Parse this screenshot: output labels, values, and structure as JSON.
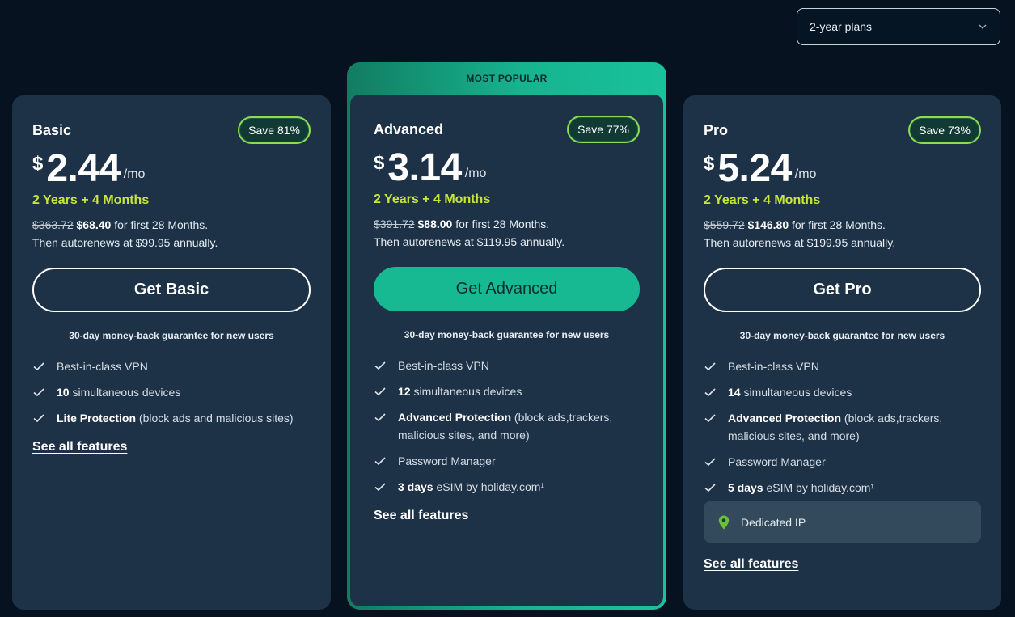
{
  "selector": {
    "value": "2-year plans",
    "icon": "chevron-down-icon"
  },
  "popular_label": "MOST POPULAR",
  "colors": {
    "accent": "#17b993",
    "duration": "#c7e637",
    "card": "#1e3247",
    "background": "#06121f",
    "pin": "#6bbf3b"
  },
  "plans": [
    {
      "name": "Basic",
      "save": "Save 81%",
      "currency": "$",
      "price": "2.44",
      "per": "/mo",
      "duration": "2 Years + 4 Months",
      "old_price": "$363.72",
      "new_price": "$68.40",
      "billing_suffix": " for first 28 Months.",
      "renew": "Then autorenews at $99.95 annually.",
      "cta": "Get Basic",
      "guarantee": "30-day money-back guarantee for new users",
      "features": [
        {
          "bold": "",
          "text": "Best-in-class VPN"
        },
        {
          "bold": "10",
          "text": " simultaneous devices"
        },
        {
          "bold": "Lite Protection",
          "text": " (block ads and malicious sites)"
        }
      ],
      "see_all": "See all features"
    },
    {
      "name": "Advanced",
      "save": "Save 77%",
      "currency": "$",
      "price": "3.14",
      "per": "/mo",
      "duration": "2 Years + 4 Months",
      "old_price": "$391.72",
      "new_price": "$88.00",
      "billing_suffix": " for first 28 Months.",
      "renew": "Then autorenews at $119.95 annually.",
      "cta": "Get Advanced",
      "guarantee": "30-day money-back guarantee for new users",
      "features": [
        {
          "bold": "",
          "text": "Best-in-class VPN"
        },
        {
          "bold": "12",
          "text": " simultaneous devices"
        },
        {
          "bold": "Advanced Protection",
          "text": " (block ads,trackers, malicious sites, and more)"
        },
        {
          "bold": "",
          "text": "Password Manager"
        },
        {
          "bold": "3 days",
          "text": " eSIM by holiday.com¹"
        }
      ],
      "see_all": "See all features"
    },
    {
      "name": "Pro",
      "save": "Save 73%",
      "currency": "$",
      "price": "5.24",
      "per": "/mo",
      "duration": "2 Years + 4 Months",
      "old_price": "$559.72",
      "new_price": "$146.80",
      "billing_suffix": " for first 28 Months.",
      "renew": "Then autorenews at $199.95 annually.",
      "cta": "Get Pro",
      "guarantee": "30-day money-back guarantee for new users",
      "features": [
        {
          "bold": "",
          "text": "Best-in-class VPN"
        },
        {
          "bold": "14",
          "text": " simultaneous devices"
        },
        {
          "bold": "Advanced Protection",
          "text": " (block ads,trackers, malicious sites, and more)"
        },
        {
          "bold": "",
          "text": "Password Manager"
        },
        {
          "bold": "5 days",
          "text": " eSIM by holiday.com¹"
        }
      ],
      "extra": {
        "label": "Dedicated IP",
        "icon": "location-pin-icon"
      },
      "see_all": "See all features"
    }
  ]
}
